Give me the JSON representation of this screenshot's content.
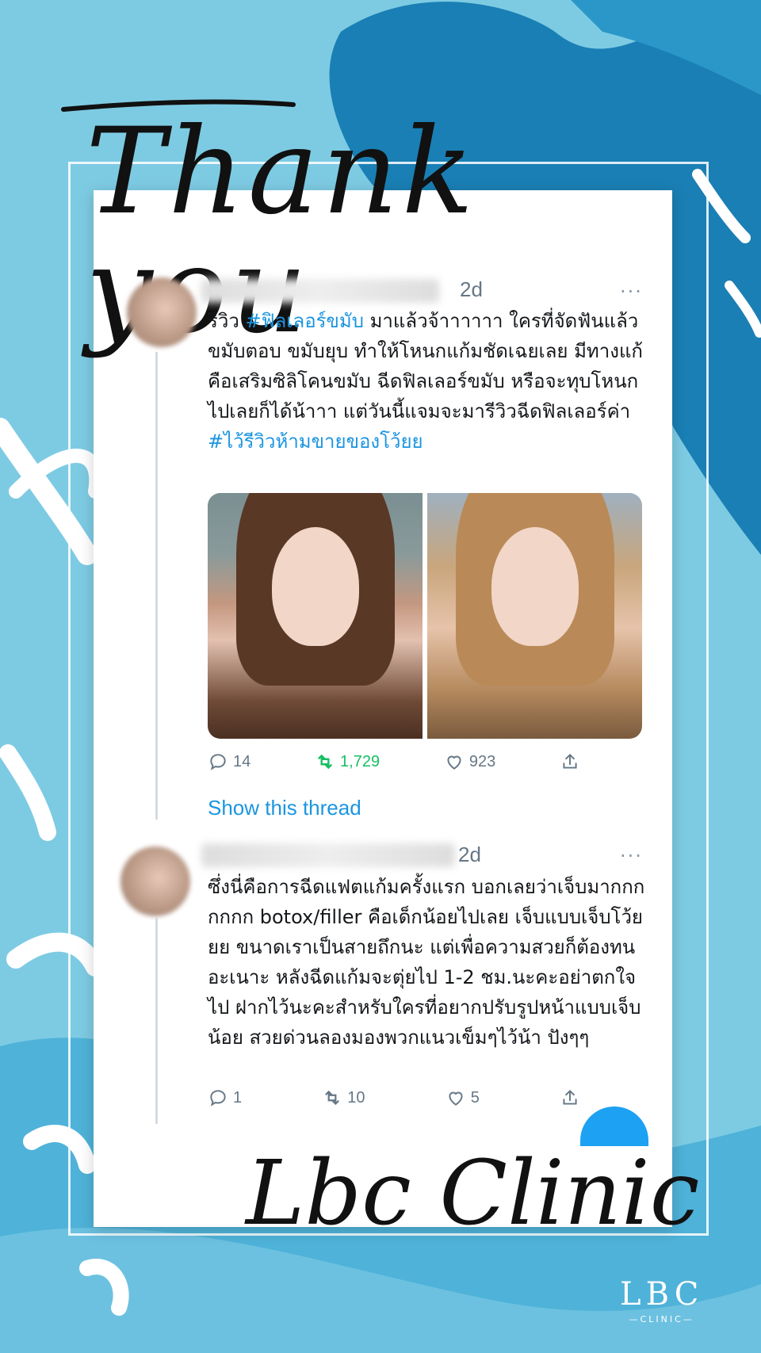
{
  "colors": {
    "background": "#7dcbe3",
    "accent_blue": "#1b95e0",
    "retweet_green": "#17bf63",
    "meta_gray": "#657786",
    "dark_stroke": "#1a7fb4"
  },
  "header": {
    "script_title": "Thank you"
  },
  "tweets": [
    {
      "time": "2d",
      "more": "···",
      "body_prefix": "รีวิว ",
      "tag1": "#ฟิลเลอร์ขมับ",
      "body_main": " มาแล้วจ้าาาาาา ใครที่จัดฟันแล้วขมับตอบ ขมับยุบ ทำให้โหนกแก้มชัดเฉยเลย มีทางแก้คือเสริมซิลิโคนขมับ ฉีดฟิลเลอร์ขมับ หรือจะทุบโหนกไปเลยก็ได้น้าาา แต่วันนี้แจมจะมารีวิวฉีดฟิลเลอร์ค่า ",
      "tag2": "#ไว้รีวิวห้ามขายของโว้ยย",
      "actions": {
        "replies": "14",
        "retweets": "1,729",
        "likes": "923"
      },
      "show_thread": "Show this thread"
    },
    {
      "time": "2d",
      "more": "···",
      "body": "ซึ่งนี่คือการฉีดแฟตแก้มครั้งแรก บอกเลยว่าเจ็บมากกกกกกก botox/filler คือเด็กน้อยไปเลย เจ็บแบบเจ็บโว้ยยย ขนาดเราเป็นสายถึกนะ แต่เพื่อความสวยก็ต้องทนอะเนาะ หลังฉีดแก้มจะตุ่ยไป 1-2 ชม.นะคะอย่าตกใจไป ฝากไว้นะคะสำหรับใครที่อยากปรับรูปหน้าแบบเจ็บน้อย สวยด่วนลองมองพวกแนวเข็มๆไว้น้า ปังๆๆ",
      "actions": {
        "replies": "1",
        "retweets": "10",
        "likes": "5"
      }
    }
  ],
  "footer": {
    "signature": "Lbc Clinic",
    "logo_main": "LBC",
    "logo_sub": "—CLINIC—"
  },
  "icons": {
    "reply": "reply-icon",
    "retweet": "retweet-icon",
    "like": "heart-icon",
    "share": "share-icon"
  }
}
